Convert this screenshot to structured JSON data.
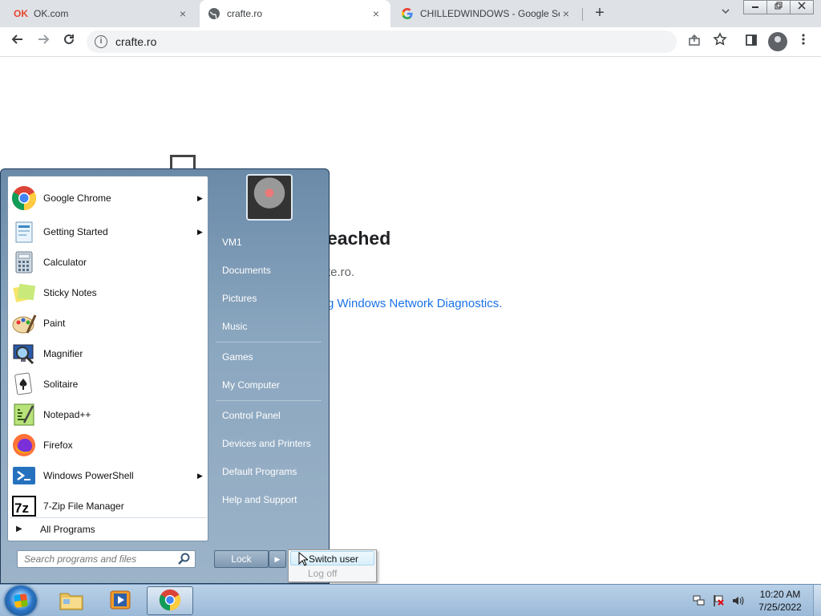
{
  "browser": {
    "tabs": [
      {
        "title": "OK.com",
        "favicon": "ok-favicon",
        "close": "×"
      },
      {
        "title": "crafte.ro",
        "favicon": "globe-icon",
        "close": "×"
      },
      {
        "title": "CHILLEDWINDOWS - Google Se",
        "favicon": "google-icon",
        "close": "×"
      }
    ],
    "new_tab": "+",
    "address": "crafte.ro",
    "page": {
      "error_title": "eached",
      "error_subtitle": "te.ro.",
      "error_link": "g Windows Network Diagnostics."
    }
  },
  "start_menu": {
    "programs": [
      {
        "label": "Google Chrome",
        "icon": "chrome-icon",
        "submenu": true
      },
      {
        "label": "Getting Started",
        "icon": "getting-started-icon",
        "submenu": true
      },
      {
        "label": "Calculator",
        "icon": "calculator-icon",
        "submenu": false
      },
      {
        "label": "Sticky Notes",
        "icon": "sticky-notes-icon",
        "submenu": false
      },
      {
        "label": "Paint",
        "icon": "paint-icon",
        "submenu": false
      },
      {
        "label": "Magnifier",
        "icon": "magnifier-icon",
        "submenu": false
      },
      {
        "label": "Solitaire",
        "icon": "solitaire-icon",
        "submenu": false
      },
      {
        "label": "Notepad++",
        "icon": "notepadpp-icon",
        "submenu": false
      },
      {
        "label": "Firefox",
        "icon": "firefox-icon",
        "submenu": false
      },
      {
        "label": "Windows PowerShell",
        "icon": "powershell-icon",
        "submenu": true
      },
      {
        "label": "7-Zip File Manager",
        "icon": "7zip-icon",
        "submenu": false
      }
    ],
    "all_programs": "All Programs",
    "search_placeholder": "Search programs and files",
    "right_links": [
      "VM1",
      "Documents",
      "Pictures",
      "Music",
      "Games",
      "My Computer",
      "Control Panel",
      "Devices and Printers",
      "Default Programs",
      "Help and Support"
    ],
    "lock_label": "Lock",
    "shutdown_submenu": {
      "switch_user": "Switch user",
      "log_off": "Log off"
    }
  },
  "taskbar": {
    "clock_time": "10:20 AM",
    "clock_date": "7/25/2022"
  }
}
